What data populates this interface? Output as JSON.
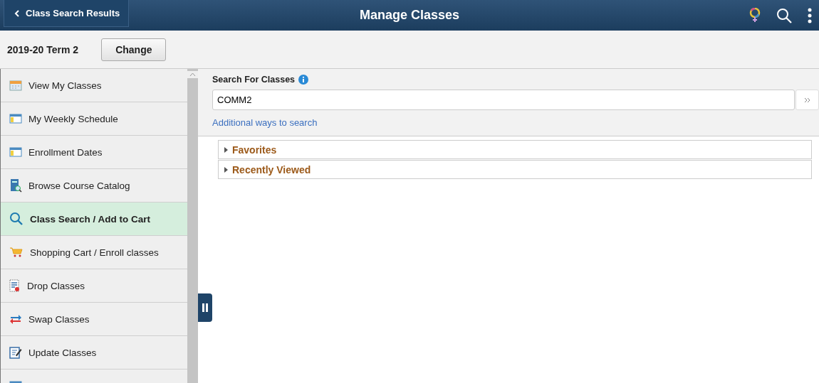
{
  "header": {
    "back_button": "Class Search Results",
    "title": "Manage Classes"
  },
  "term": {
    "label": "2019-20 Term 2",
    "button": "Change"
  },
  "sidebar": {
    "items": [
      {
        "label": "View My Classes",
        "kind": "calendar",
        "selected": false
      },
      {
        "label": "My Weekly Schedule",
        "kind": "schedule",
        "selected": false
      },
      {
        "label": "Enrollment Dates",
        "kind": "schedule",
        "selected": false
      },
      {
        "label": "Browse Course Catalog",
        "kind": "catalog",
        "selected": false
      },
      {
        "label": "Class Search / Add to Cart",
        "kind": "search",
        "selected": true
      },
      {
        "label": "Shopping Cart / Enroll classes",
        "kind": "cart",
        "selected": false
      },
      {
        "label": "Drop Classes",
        "kind": "drop",
        "selected": false
      },
      {
        "label": "Swap Classes",
        "kind": "swap",
        "selected": false
      },
      {
        "label": "Update Classes",
        "kind": "edit",
        "selected": false
      },
      {
        "kind": "schedule",
        "selected": false
      }
    ]
  },
  "search": {
    "label": "Search For Classes",
    "value": "COMM2",
    "link": "Additional ways to search"
  },
  "sections": [
    {
      "label": "Favorites",
      "expanded": false
    },
    {
      "label": "Recently Viewed",
      "expanded": false
    }
  ]
}
